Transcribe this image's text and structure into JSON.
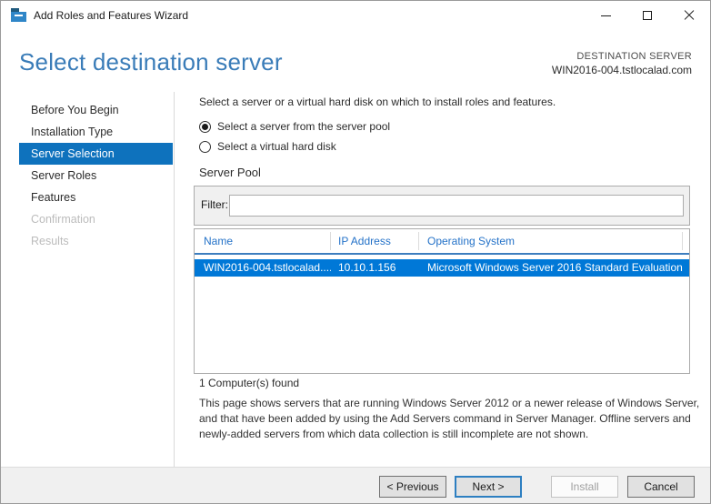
{
  "window": {
    "title": "Add Roles and Features Wizard"
  },
  "header": {
    "title": "Select destination server",
    "destination_label": "DESTINATION SERVER",
    "destination_server": "WIN2016-004.tstlocalad.com"
  },
  "sidebar": {
    "items": [
      {
        "label": "Before You Begin",
        "state": "normal"
      },
      {
        "label": "Installation Type",
        "state": "normal"
      },
      {
        "label": "Server Selection",
        "state": "selected"
      },
      {
        "label": "Server Roles",
        "state": "normal"
      },
      {
        "label": "Features",
        "state": "normal"
      },
      {
        "label": "Confirmation",
        "state": "disabled"
      },
      {
        "label": "Results",
        "state": "disabled"
      }
    ]
  },
  "main": {
    "intro": "Select a server or a virtual hard disk on which to install roles and features.",
    "radios": [
      {
        "label": "Select a server from the server pool",
        "selected": true
      },
      {
        "label": "Select a virtual hard disk",
        "selected": false
      }
    ],
    "server_pool": {
      "title": "Server Pool",
      "filter_label": "Filter:",
      "filter_value": "",
      "table": {
        "columns": [
          "Name",
          "IP Address",
          "Operating System"
        ],
        "rows": [
          {
            "name": "WIN2016-004.tstlocalad....",
            "ip": "10.10.1.156",
            "os": "Microsoft Windows Server 2016 Standard Evaluation",
            "selected": true
          }
        ]
      },
      "count_text": "1 Computer(s) found"
    },
    "description": "This page shows servers that are running Windows Server 2012 or a newer release of Windows Server, and that have been added by using the Add Servers command in Server Manager. Offline servers and newly-added servers from which data collection is still incomplete are not shown."
  },
  "footer": {
    "buttons": [
      {
        "label": "< Previous",
        "state": "normal"
      },
      {
        "label": "Next >",
        "state": "default"
      },
      {
        "label": "Install",
        "state": "disabled"
      },
      {
        "label": "Cancel",
        "state": "normal"
      }
    ]
  },
  "colors": {
    "accent": "#0078d7",
    "sidebar_selected_bg": "#0e72bd",
    "heading_text": "#3a7cb8",
    "table_header_text": "#2472c8",
    "selected_row_bg": "#0078d7",
    "footer_bg": "#f0f0f0"
  }
}
